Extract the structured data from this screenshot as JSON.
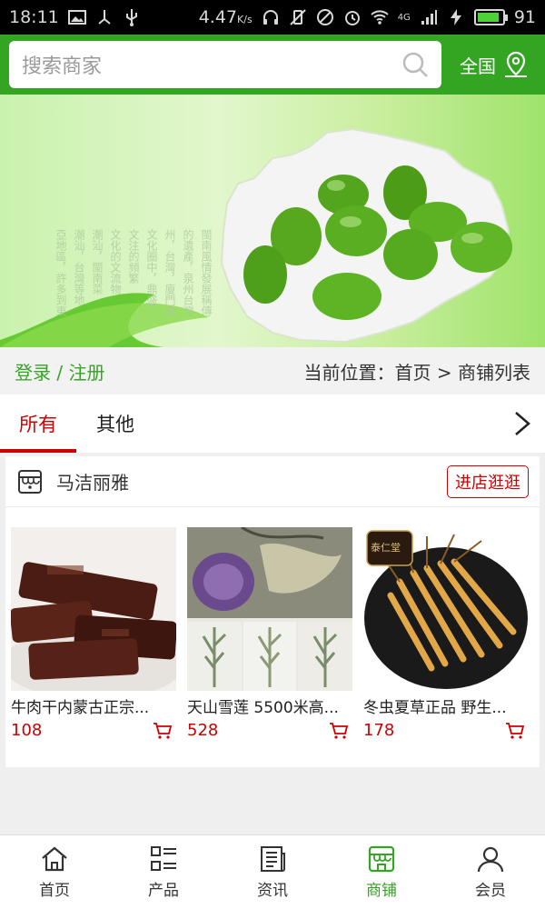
{
  "status_bar": {
    "time": "18:11",
    "speed": "4.47",
    "speed_unit": "K/s",
    "network": "4G",
    "battery": "91",
    "battery_level": 0.91
  },
  "header": {
    "search_placeholder": "搜索商家",
    "region_label": "全国",
    "search_icon": "search-icon",
    "region_icon": "location-pin-icon",
    "brand_color": "#34a423"
  },
  "banner": {
    "poem_lines": [
      "閩南風情發展稱傳",
      "的遺產，泉州台灣",
      "州，台灣，廈門廣",
      "文化圈中，鼎盛",
      "文注的頻繁",
      "文化的文流物",
      "潮汕，閩南菜",
      "潮汕，台灣等地",
      "亞地區，許多到東"
    ]
  },
  "breadcrumb": {
    "auth": "登录 / 注册",
    "location": "当前位置：首页 > 商铺列表"
  },
  "tabs": {
    "items": [
      "所有",
      "其他"
    ],
    "active_color": "#cc0000"
  },
  "store": {
    "name": "马洁丽雅",
    "visit_label": "进店逛逛",
    "store_icon": "store-icon",
    "products": [
      {
        "name": "牛肉干内蒙古正宗...",
        "price": "108"
      },
      {
        "name": "天山雪莲 5500米高...",
        "price": "528"
      },
      {
        "name": "冬虫夏草正品 野生...",
        "price": "178"
      }
    ],
    "product3_brand": "泰仁堂"
  },
  "bottom_nav": {
    "items": [
      {
        "label": "首页",
        "icon": "home-icon"
      },
      {
        "label": "产品",
        "icon": "grid-list-icon"
      },
      {
        "label": "资讯",
        "icon": "news-icon"
      },
      {
        "label": "商铺",
        "icon": "store-icon"
      },
      {
        "label": "会员",
        "icon": "user-icon"
      }
    ],
    "active_index": 3
  }
}
